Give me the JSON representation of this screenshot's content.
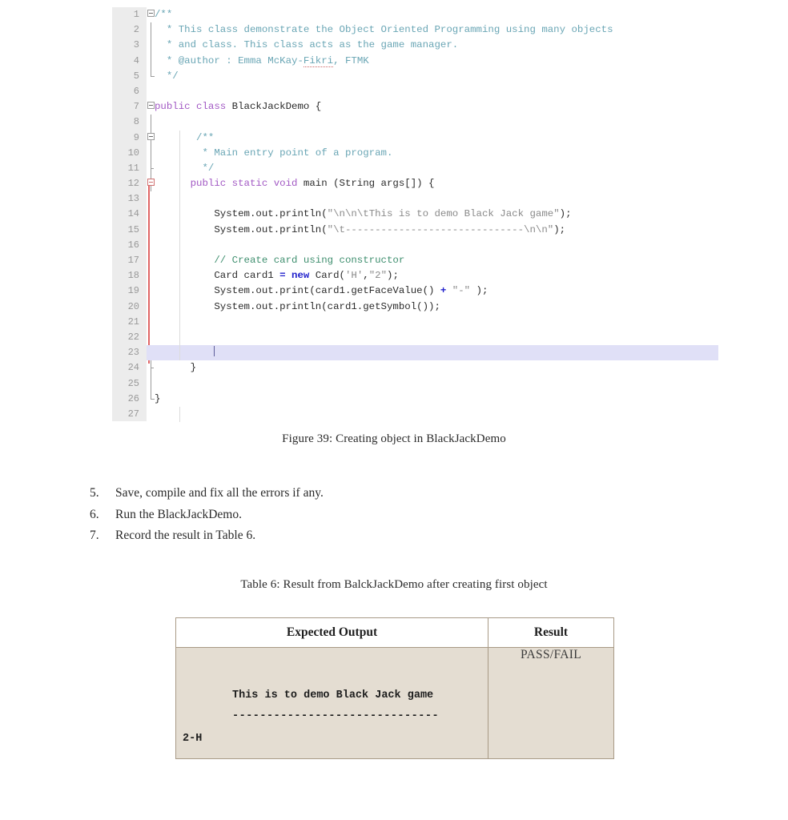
{
  "document": {
    "figure_caption": "Figure 39: Creating object in BlackJackDemo",
    "table_caption": "Table 6: Result from BalckJackDemo after creating first object"
  },
  "code_editor": {
    "language": "java",
    "cursor_line": 23,
    "highlight_color": "#e0e0f7",
    "gutter_color": "#ececec",
    "error_bar_color": "#e06666",
    "lines": [
      {
        "num": "1",
        "text": "/**"
      },
      {
        "num": "2",
        "text": " * This class demonstrate the Object Oriented Programming using many objects"
      },
      {
        "num": "3",
        "text": " * and class. This class acts as the game manager."
      },
      {
        "num": "4",
        "text": " * @author : Emma McKay-Fikri, FTMK"
      },
      {
        "num": "5",
        "text": " */"
      },
      {
        "num": "6",
        "text": ""
      },
      {
        "num": "7",
        "text": "public class BlackJackDemo {"
      },
      {
        "num": "8",
        "text": ""
      },
      {
        "num": "9",
        "text": "    /**"
      },
      {
        "num": "10",
        "text": "     * Main entry point of a program."
      },
      {
        "num": "11",
        "text": "     */"
      },
      {
        "num": "12",
        "text": "    public static void main (String args[]) {"
      },
      {
        "num": "13",
        "text": ""
      },
      {
        "num": "14",
        "text": "        System.out.println(\"\\n\\n\\tThis is to demo Black Jack game\");"
      },
      {
        "num": "15",
        "text": "        System.out.println(\"\\t------------------------------\\n\\n\");"
      },
      {
        "num": "16",
        "text": ""
      },
      {
        "num": "17",
        "text": "        // Create card using constructor"
      },
      {
        "num": "18",
        "text": "        Card card1 = new Card('H',\"2\");"
      },
      {
        "num": "19",
        "text": "        System.out.print(card1.getFaceValue() + \"-\" );"
      },
      {
        "num": "20",
        "text": "        System.out.println(card1.getSymbol());"
      },
      {
        "num": "21",
        "text": ""
      },
      {
        "num": "22",
        "text": ""
      },
      {
        "num": "23",
        "text": ""
      },
      {
        "num": "24",
        "text": "    }"
      },
      {
        "num": "25",
        "text": ""
      },
      {
        "num": "26",
        "text": "}"
      },
      {
        "num": "27",
        "text": ""
      }
    ]
  },
  "steps": [
    {
      "num": "5.",
      "text": "Save, compile and fix all the errors if any."
    },
    {
      "num": "6.",
      "text": "Run the BlackJackDemo."
    },
    {
      "num": "7.",
      "text": "Record the result in Table 6."
    }
  ],
  "result_table": {
    "headers": [
      "Expected Output",
      "Result"
    ],
    "rows": [
      {
        "expected_output_lines": [
          "This is to demo Black Jack game",
          "------------------------------",
          "2-H"
        ],
        "result": "PASS/FAIL"
      }
    ]
  }
}
